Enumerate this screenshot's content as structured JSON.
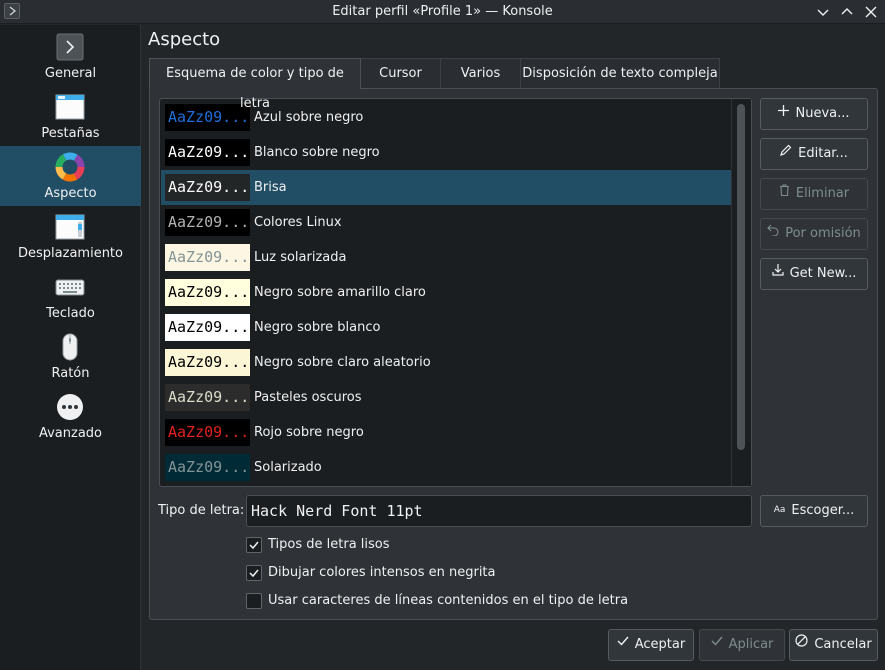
{
  "window": {
    "title": "Editar perfil «Profile 1» — Konsole"
  },
  "sidebar": {
    "items": [
      {
        "label": "General",
        "icon": "terminal-icon",
        "selected": false
      },
      {
        "label": "Pestañas",
        "icon": "tabs-icon",
        "selected": false
      },
      {
        "label": "Aspecto",
        "icon": "color-wheel-icon",
        "selected": true
      },
      {
        "label": "Desplazamiento",
        "icon": "scroll-icon",
        "selected": false
      },
      {
        "label": "Teclado",
        "icon": "keyboard-icon",
        "selected": false
      },
      {
        "label": "Ratón",
        "icon": "mouse-icon",
        "selected": false
      },
      {
        "label": "Avanzado",
        "icon": "more-icon",
        "selected": false
      }
    ]
  },
  "page": {
    "title": "Aspecto"
  },
  "tabs": [
    {
      "label": "Esquema de color y tipo de letra",
      "active": true
    },
    {
      "label": "Cursor",
      "active": false
    },
    {
      "label": "Varios",
      "active": false
    },
    {
      "label": "Disposición de texto compleja",
      "active": false
    }
  ],
  "schemes": [
    {
      "preview": "AaZz09...",
      "name": "Azul sobre negro",
      "bg": "#000000",
      "fg": "#1e6fdc",
      "selected": false
    },
    {
      "preview": "AaZz09...",
      "name": "Blanco sobre negro",
      "bg": "#000000",
      "fg": "#ffffff",
      "selected": false
    },
    {
      "preview": "AaZz09...",
      "name": "Brisa",
      "bg": "#232627",
      "fg": "#fcfcfc",
      "selected": true
    },
    {
      "preview": "AaZz09...",
      "name": "Colores Linux",
      "bg": "#000000",
      "fg": "#b2b2b2",
      "selected": false
    },
    {
      "preview": "AaZz09...",
      "name": "Luz solarizada",
      "bg": "#fdf6e3",
      "fg": "#839496",
      "selected": false
    },
    {
      "preview": "AaZz09...",
      "name": "Negro sobre amarillo claro",
      "bg": "#ffffdd",
      "fg": "#000000",
      "selected": false
    },
    {
      "preview": "AaZz09...",
      "name": "Negro sobre blanco",
      "bg": "#ffffff",
      "fg": "#000000",
      "selected": false
    },
    {
      "preview": "AaZz09...",
      "name": "Negro sobre claro aleatorio",
      "bg": "#fbf7d6",
      "fg": "#000000",
      "selected": false
    },
    {
      "preview": "AaZz09...",
      "name": "Pasteles oscuros",
      "bg": "#2c2c2c",
      "fg": "#dcdccc",
      "selected": false
    },
    {
      "preview": "AaZz09...",
      "name": "Rojo sobre negro",
      "bg": "#000000",
      "fg": "#e0211d",
      "selected": false
    },
    {
      "preview": "AaZz09...",
      "name": "Solarizado",
      "bg": "#002b36",
      "fg": "#839496",
      "selected": false
    }
  ],
  "scheme_buttons": {
    "new": "Nueva...",
    "edit": "Editar...",
    "delete": "Eliminar",
    "default": "Por omisión",
    "get_new": "Get New..."
  },
  "font": {
    "label": "Tipo de letra:",
    "value": "Hack Nerd Font 11pt",
    "choose": "Escoger..."
  },
  "options": [
    {
      "label": "Tipos de letra lisos",
      "checked": true
    },
    {
      "label": "Dibujar colores intensos en negrita",
      "checked": true
    },
    {
      "label": "Usar caracteres de líneas contenidos en el tipo de letra",
      "checked": false
    }
  ],
  "dialog_buttons": {
    "ok": "Aceptar",
    "apply": "Aplicar",
    "cancel": "Cancelar"
  },
  "colors": {
    "accent": "#224e65",
    "background": "#232629",
    "panel": "#2f3337",
    "text": "#eff0f1",
    "disabled_text": "#7f8c8d"
  }
}
